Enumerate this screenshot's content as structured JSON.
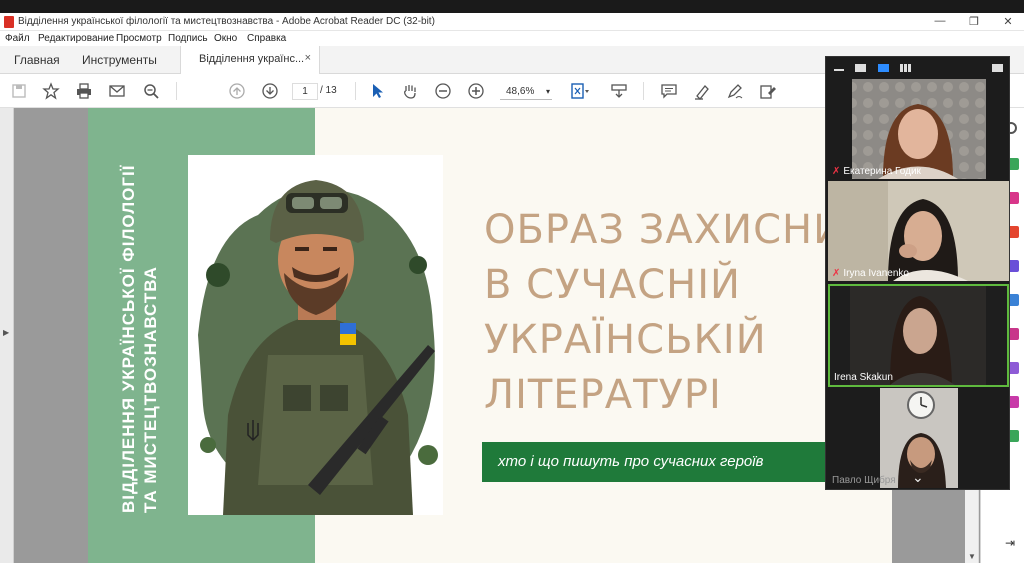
{
  "window": {
    "title": "Відділення української філології та мистецтвознавства - Adobe Acrobat Reader DC (32-bit)",
    "min": "—",
    "max": "❐",
    "close": "✕"
  },
  "menu": [
    "Файл",
    "Редактирование",
    "Просмотр",
    "Подпись",
    "Окно",
    "Справка"
  ],
  "tabs": {
    "home": "Главная",
    "tools": "Инструменты",
    "doc": "Відділення украïнс...",
    "close": "×"
  },
  "toolbar": {
    "page_current": "1",
    "page_total": "/ 13",
    "zoom": "48,6%",
    "zoom_caret": "▾"
  },
  "slide": {
    "vertical_line1": "ВІДДІЛЕННЯ УКРАЇНСЬКОЇ ФІЛОЛОГІЇ",
    "vertical_line2": "ТА МИСТЕЦТВОЗНАВСТВА",
    "headline": [
      "ОБРАЗ ЗАХИСНИКА",
      "В СУЧАСНІЙ",
      "УКРАЇНСЬКІЙ",
      "ЛІТЕРАТУРІ"
    ],
    "subtitle": "хто і що пишуть про сучасних героїв"
  },
  "meeting": {
    "participants": [
      {
        "name": "Екатерина Годик",
        "muted": true
      },
      {
        "name": "Iryna Ivanenko",
        "muted": true
      },
      {
        "name": "Irena Skakun",
        "muted": false,
        "active": true
      },
      {
        "name": "Павло Щибря",
        "muted": false
      }
    ],
    "more": "⌄"
  },
  "colors": {
    "slide_green": "#7fb48e",
    "headline": "#c4a383",
    "subtitle_bar": "#1f7a3a",
    "active_speaker": "#5fba3e"
  }
}
